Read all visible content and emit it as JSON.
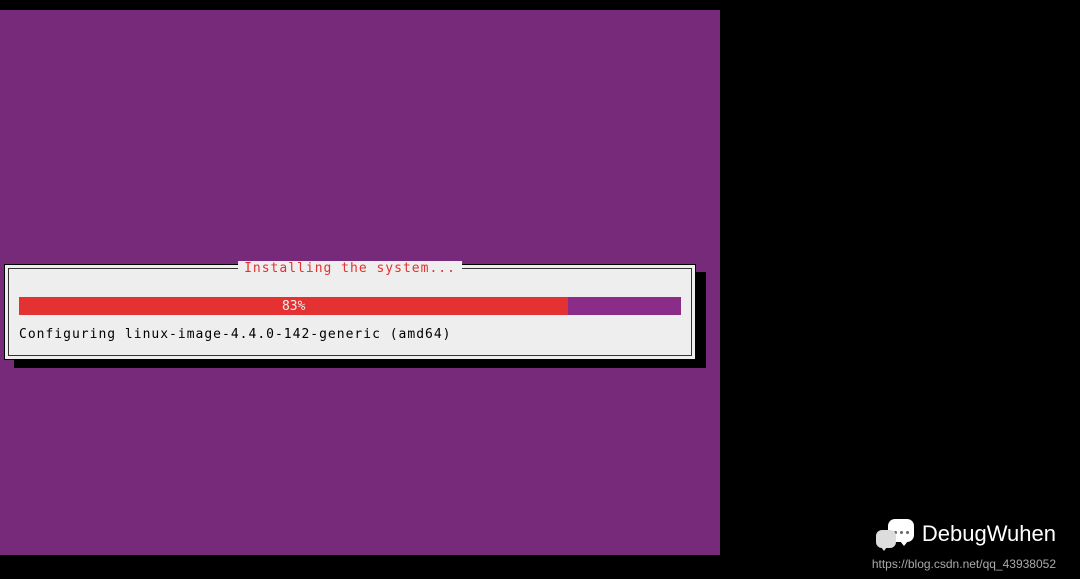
{
  "installer": {
    "dialog": {
      "title": "Installing the system...",
      "progress_percent": 83,
      "progress_label": "83%",
      "status_text": "Configuring linux-image-4.4.0-142-generic (amd64)"
    }
  },
  "watermark": {
    "name": "DebugWuhen",
    "url": "https://blog.csdn.net/qq_43938052"
  },
  "colors": {
    "installer_bg": "#772a79",
    "dialog_bg": "#eee",
    "accent_red": "#e43131",
    "progress_track": "#8b2d88"
  }
}
